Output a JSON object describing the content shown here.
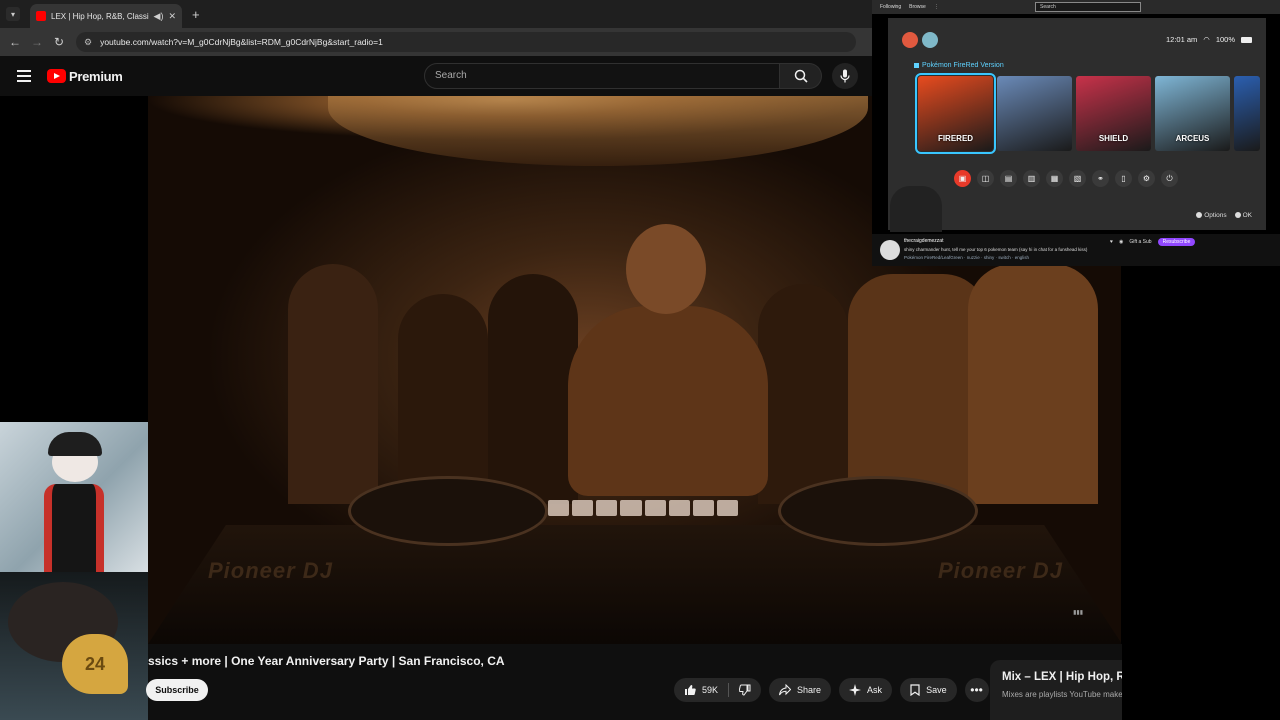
{
  "browser": {
    "tab_title": "LEX | Hip Hop, R&B, Classic",
    "url": "youtube.com/watch?v=M_g0CdrNjBg&list=RDM_g0CdrNjBg&start_radio=1"
  },
  "youtube": {
    "logo_text": "Premium",
    "search_placeholder": "Search"
  },
  "video": {
    "title": "ssics + more | One Year Anniversary Party | San Francisco, CA",
    "brand_left": "Pioneer DJ",
    "brand_right": "Pioneer DJ"
  },
  "actions": {
    "subscribe": "Subscribe",
    "like_count": "59K",
    "share": "Share",
    "ask": "Ask",
    "save": "Save"
  },
  "mix_panel": {
    "title": "Mix – LEX | Hip Hop, R&B, Classics +…",
    "subtitle": "Mixes are playlists YouTube makes for you"
  },
  "webcam": {
    "jersey_number": "24"
  },
  "stream_overlay": {
    "menu_items": [
      "Following",
      "Browse"
    ],
    "search_placeholder": "Search",
    "time": "12:01 am",
    "battery": "100%",
    "game_title": "Pokémon FireRed Version",
    "tiles": [
      {
        "label": "FIRERED",
        "color": "#e84b1f"
      },
      {
        "label": "",
        "color": "#6a8ab8"
      },
      {
        "label": "SHIELD",
        "color": "#c8324a"
      },
      {
        "label": "ARCEUS",
        "color": "#7fb6d6"
      },
      {
        "label": "",
        "color": "#2b5fb0"
      }
    ],
    "options_label": "Options",
    "ok_label": "OK",
    "chat_name": "thecraigdemezzat",
    "chat_message": "shiny charmander hunt, tell me your top 6 pokemon team (say hi in chat for a funshead kiss)",
    "chat_tags": "Pokémon FireRed/LeafGreen · nuzzie · shiny · switch · english",
    "follow_label": "Gift a Sub",
    "subscribe_label": "Resubscribe"
  },
  "colors": {
    "accent_red": "#ff0000",
    "switch_highlight": "#39c6ff",
    "twitch_purple": "#9147ff"
  }
}
